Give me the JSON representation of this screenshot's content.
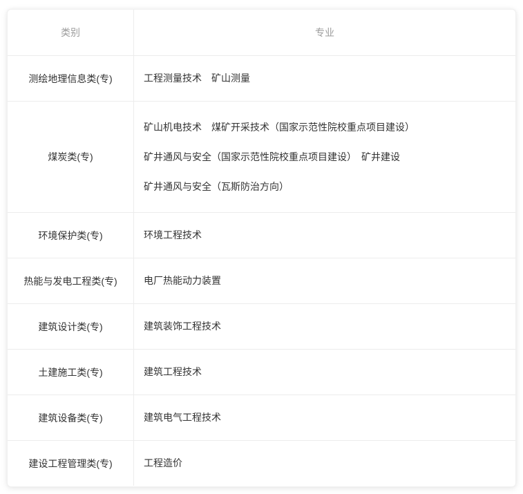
{
  "table": {
    "headers": {
      "category": "类别",
      "major": "专业"
    },
    "rows": [
      {
        "category": "测绘地理信息类(专)",
        "majors": [
          "工程测量技术　矿山测量"
        ]
      },
      {
        "category": "煤炭类(专)",
        "majors": [
          "矿山机电技术　煤矿开采技术（国家示范性院校重点项目建设）",
          "矿井通风与安全（国家示范性院校重点项目建设）　矿井建设",
          "矿井通风与安全（瓦斯防治方向）"
        ]
      },
      {
        "category": "环境保护类(专)",
        "majors": [
          "环境工程技术"
        ]
      },
      {
        "category": "热能与发电工程类(专)",
        "majors": [
          "电厂热能动力装置"
        ]
      },
      {
        "category": "建筑设计类(专)",
        "majors": [
          "建筑装饰工程技术"
        ]
      },
      {
        "category": "土建施工类(专)",
        "majors": [
          "建筑工程技术"
        ]
      },
      {
        "category": "建筑设备类(专)",
        "majors": [
          "建筑电气工程技术"
        ]
      },
      {
        "category": "建设工程管理类(专)",
        "majors": [
          "工程造价"
        ]
      }
    ],
    "colors": {
      "header_text": "#9b9b9b",
      "body_text": "#333333",
      "border": "#ececec",
      "card_background": "#ffffff"
    }
  }
}
